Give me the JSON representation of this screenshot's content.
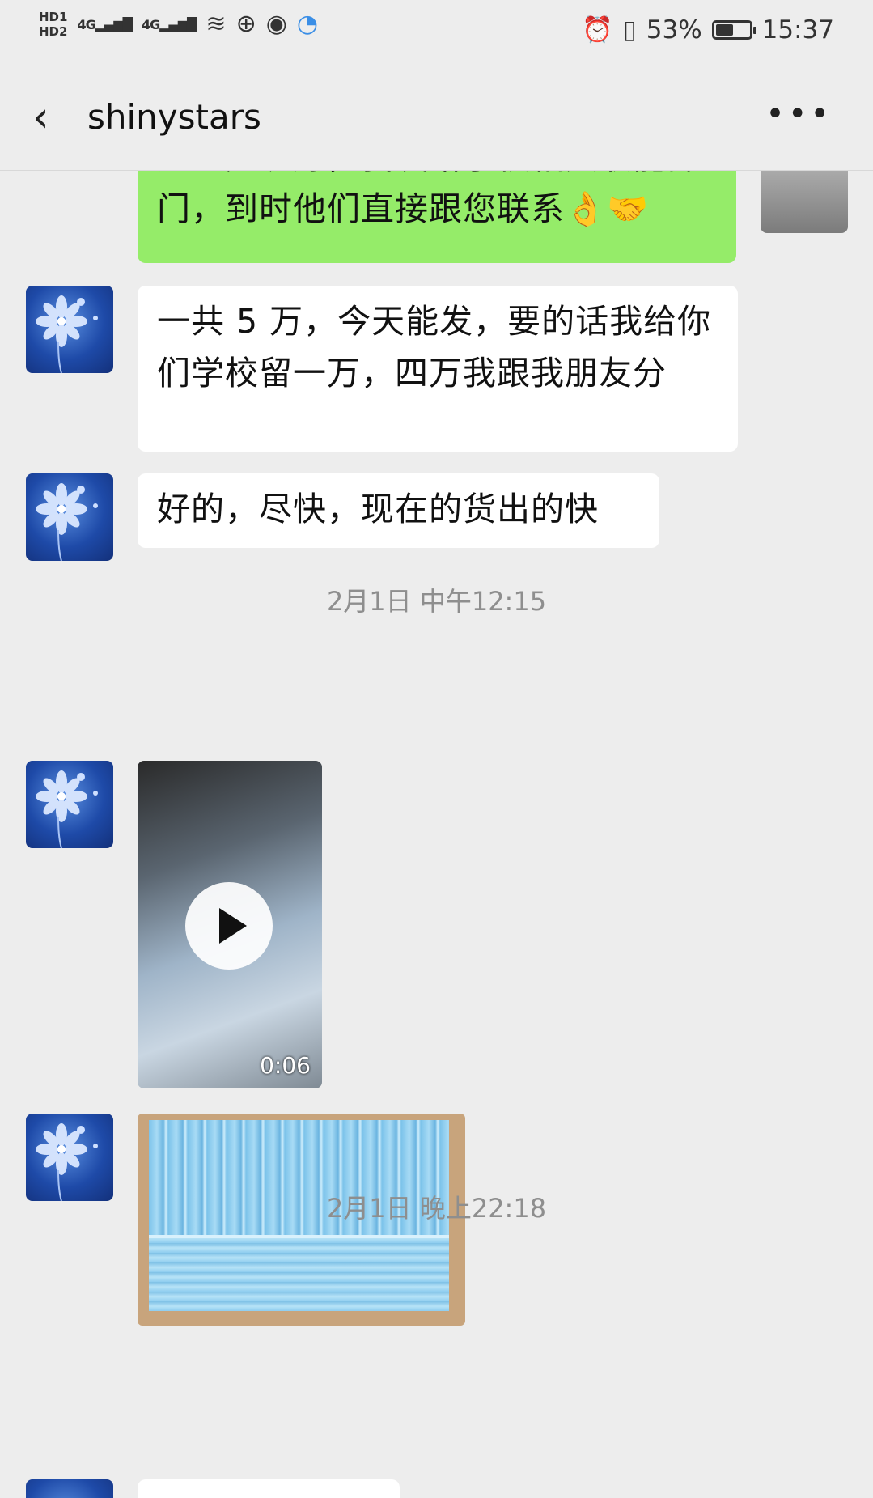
{
  "status_bar": {
    "left_indicators": [
      "HD1",
      "HD2",
      "4G",
      "4G"
    ],
    "battery_percent": "53%",
    "battery_level": 0.53,
    "time": "15:37"
  },
  "header": {
    "back_icon": "back-arrow-icon",
    "title": "shinystars",
    "more_icon": "more-icon"
  },
  "messages": [
    {
      "side": "right",
      "type": "text",
      "text": "这么先说好，我发给了校相关职能部门，到时他们直接跟您联系👌🤝"
    },
    {
      "side": "left",
      "type": "text",
      "text": "一共 5 万，今天能发，要的话我给你们学校留一万，四万我跟我朋友分"
    },
    {
      "side": "left",
      "type": "text",
      "text": "好的，尽快，现在的货出的快"
    },
    {
      "type": "time",
      "text": "2月1日 中午12:15"
    },
    {
      "side": "left",
      "type": "video",
      "duration": "0:06"
    },
    {
      "side": "left",
      "type": "image"
    },
    {
      "type": "time",
      "text": "2月1日 晚上22:18"
    }
  ]
}
